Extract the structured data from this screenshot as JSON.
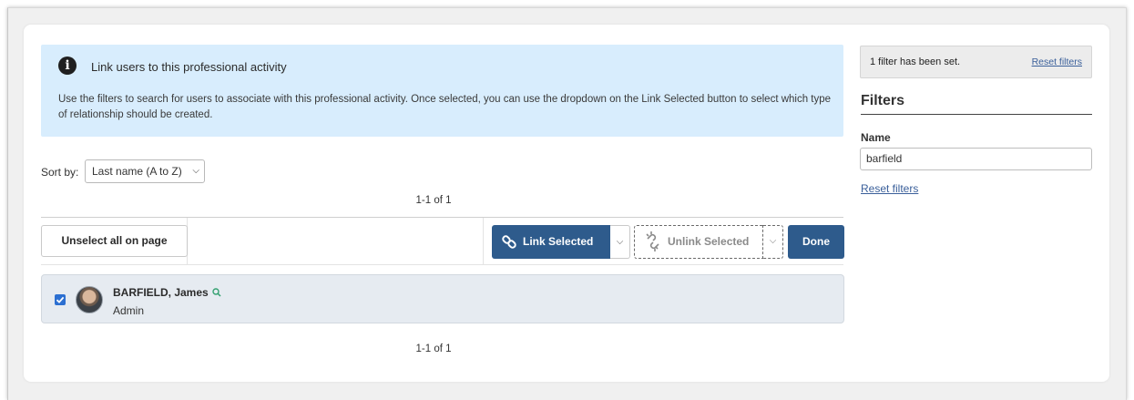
{
  "info": {
    "title": "Link users to this professional activity",
    "body": "Use the filters to search for users to associate with this professional activity. Once selected, you can use the dropdown on the Link Selected button to select which type of relationship should be created."
  },
  "sort": {
    "label": "Sort by:",
    "selected": "Last name (A to Z)"
  },
  "pager": {
    "top": "1-1 of 1",
    "bottom": "1-1 of 1"
  },
  "toolbar": {
    "unselect_label": "Unselect all on page",
    "link_label": "Link Selected",
    "unlink_label": "Unlink Selected",
    "done_label": "Done"
  },
  "users": [
    {
      "name": "BARFIELD, James",
      "role": "Admin",
      "checked": true
    }
  ],
  "filters_panel": {
    "status_text": "1 filter has been set.",
    "status_reset": "Reset filters",
    "title": "Filters",
    "name_label": "Name",
    "name_value": "barfield",
    "reset_label": "Reset filters"
  },
  "colors": {
    "primary": "#2e5b8c",
    "info_bg": "#d8edfd",
    "row_bg": "#e6ebf1"
  },
  "icons": {
    "info": "info-circle-icon",
    "link": "link-icon",
    "unlink": "unlink-icon",
    "search": "search-icon",
    "chevron": "chevron-down-icon"
  }
}
